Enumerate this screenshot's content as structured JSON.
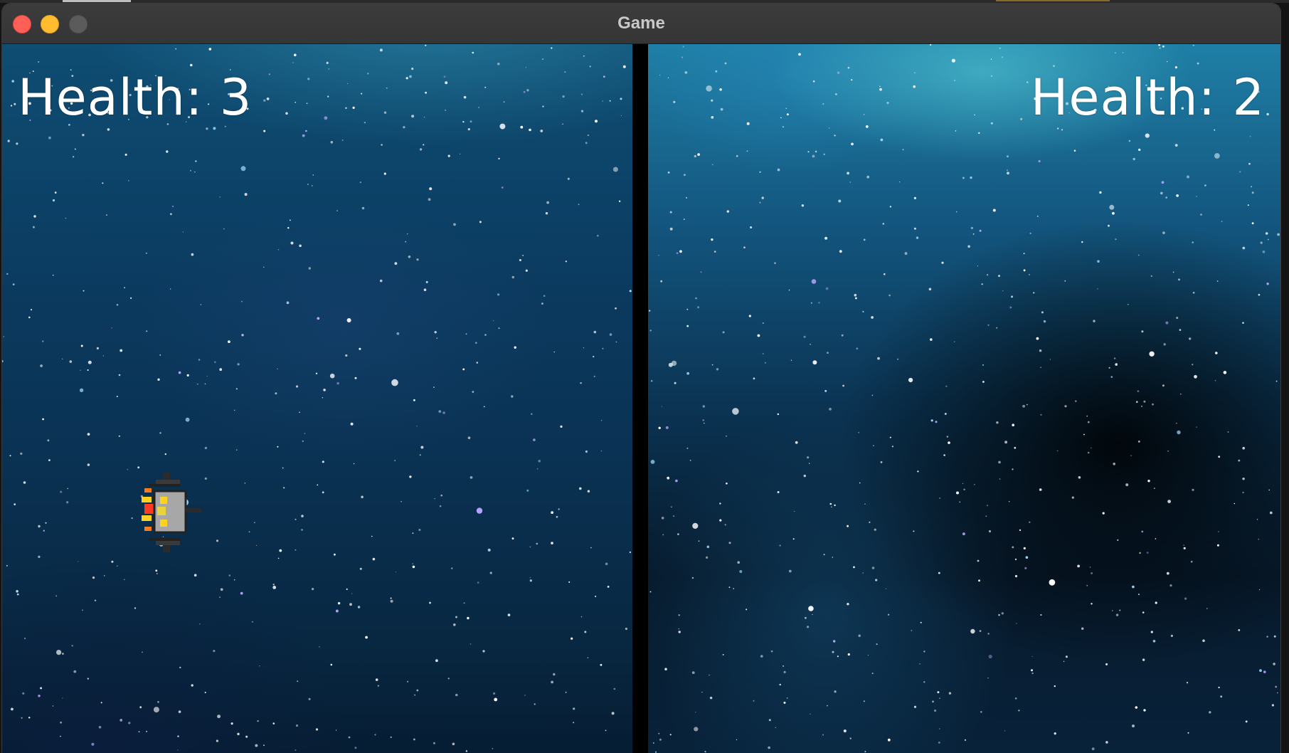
{
  "window": {
    "title": "Game"
  },
  "players": [
    {
      "health_text": "Health: 3",
      "health": 3,
      "ship_color": "#a7a7a7",
      "accent": "#ffd21f"
    },
    {
      "health_text": "Health: 2",
      "health": 2,
      "ship_color": "#a77f6a",
      "accent": "#ff3b1f"
    }
  ],
  "icons": {
    "close": "close-icon",
    "minimize": "minimize-icon",
    "maximize": "maximize-icon",
    "player1_ship": "spaceship-icon",
    "player2_ship": "spaceship-icon"
  },
  "colors": {
    "traffic_close": "#fe5f57",
    "traffic_minimize": "#febc2e",
    "traffic_maximize": "#5b5b5b",
    "divider": "#000000",
    "hud_text": "#ffffff"
  }
}
